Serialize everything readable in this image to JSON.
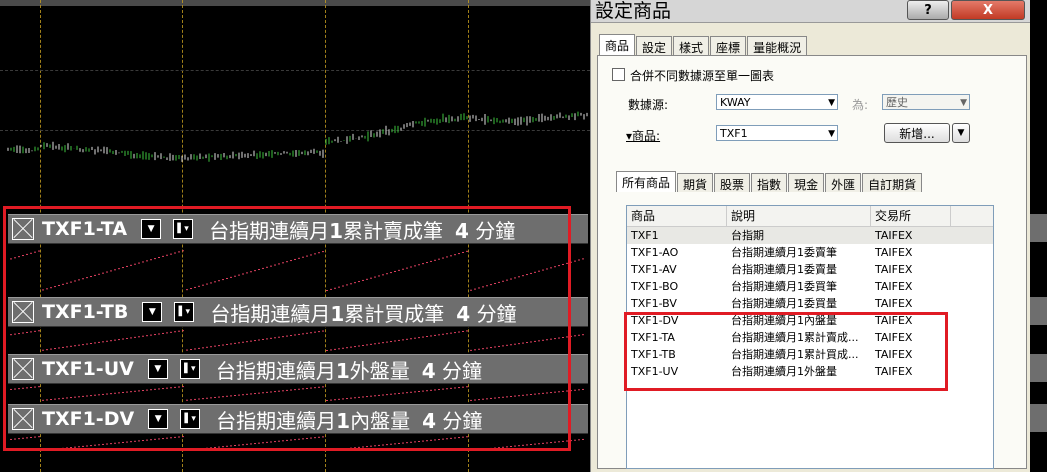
{
  "panels": [
    {
      "symbol": "TXF1-TA",
      "desc_pre": "台指期連續月",
      "desc_num": "1",
      "desc_post": "累計賣成筆",
      "period_num": "4",
      "period_unit": "分鐘"
    },
    {
      "symbol": "TXF1-TB",
      "desc_pre": "台指期連續月",
      "desc_num": "1",
      "desc_post": "累計買成筆",
      "period_num": "4",
      "period_unit": "分鐘"
    },
    {
      "symbol": "TXF1-UV",
      "desc_pre": "台指期連續月",
      "desc_num": "1",
      "desc_post": "外盤量",
      "period_num": "4",
      "period_unit": "分鐘"
    },
    {
      "symbol": "TXF1-DV",
      "desc_pre": "台指期連續月",
      "desc_num": "1",
      "desc_post": "內盤量",
      "period_num": "4",
      "period_unit": "分鐘"
    }
  ],
  "dialog": {
    "title": "設定商品",
    "help_label": "?",
    "close_label": "X",
    "tabs": [
      "商品",
      "設定",
      "樣式",
      "座標",
      "量能概況"
    ],
    "merge_checkbox_label": "合併不同數據源至單一圖表",
    "datasource_label": "數據源:",
    "datasource_value": "KWAY",
    "type_label": "為:",
    "type_value": "歷史",
    "symbol_label": "商品:",
    "symbol_value": "TXF1",
    "add_button": "新增...",
    "category_tabs": [
      "所有商品",
      "期貨",
      "股票",
      "指數",
      "現金",
      "外匯",
      "自訂期貨"
    ],
    "columns": [
      "商品",
      "說明",
      "交易所"
    ],
    "rows": [
      {
        "symbol": "TXF1",
        "desc": "台指期",
        "exchange": "TAIFEX"
      },
      {
        "symbol": "TXF1-AO",
        "desc": "台指期連續月1委賣筆",
        "exchange": "TAIFEX"
      },
      {
        "symbol": "TXF1-AV",
        "desc": "台指期連續月1委賣量",
        "exchange": "TAIFEX"
      },
      {
        "symbol": "TXF1-BO",
        "desc": "台指期連續月1委買筆",
        "exchange": "TAIFEX"
      },
      {
        "symbol": "TXF1-BV",
        "desc": "台指期連續月1委買量",
        "exchange": "TAIFEX"
      },
      {
        "symbol": "TXF1-DV",
        "desc": "台指期連續月1內盤量",
        "exchange": "TAIFEX"
      },
      {
        "symbol": "TXF1-TA",
        "desc": "台指期連續月1累計賣成...",
        "exchange": "TAIFEX"
      },
      {
        "symbol": "TXF1-TB",
        "desc": "台指期連續月1累計買成...",
        "exchange": "TAIFEX"
      },
      {
        "symbol": "TXF1-UV",
        "desc": "台指期連續月1外盤量",
        "exchange": "TAIFEX"
      }
    ]
  },
  "colors": {
    "highlight": "#e01b24",
    "panel_bar": "#6e6e6e",
    "candle_up": "#3ec43e",
    "candle_down": "#e0e0e0",
    "volume": "#e04060"
  }
}
